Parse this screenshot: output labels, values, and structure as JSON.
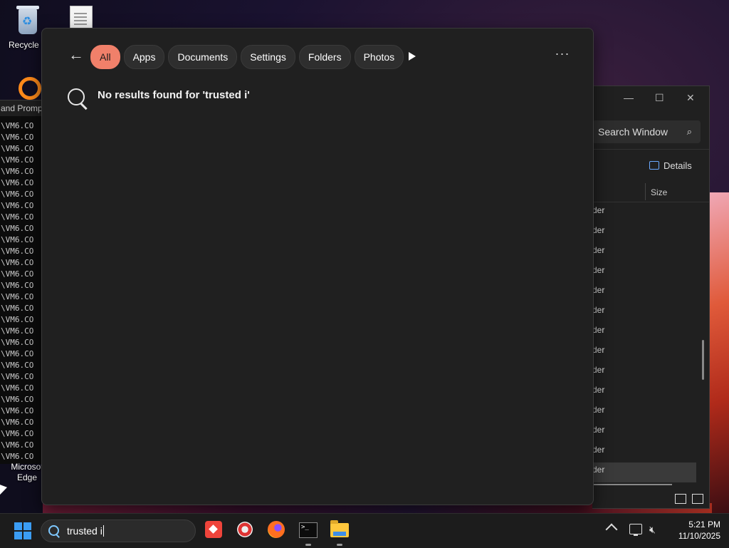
{
  "desktop": {
    "recycle_bin_label": "Recycle B",
    "edge_label_line1": "Microsof",
    "edge_label_line2": "Edge"
  },
  "cmd": {
    "title": "and Prompt",
    "line_text": "\\VM6.CO",
    "line_count": 30
  },
  "explorer": {
    "search_placeholder": "Search Window",
    "details_label": "Details",
    "size_header": "Size",
    "row_text": "der",
    "row_count": 14
  },
  "search": {
    "filters": [
      "All",
      "Apps",
      "Documents",
      "Settings",
      "Folders",
      "Photos"
    ],
    "active_filter": "All",
    "more_label": "···",
    "no_results_message": "No results found for 'trusted i'"
  },
  "taskbar": {
    "search_text": "trusted i",
    "time": "5:21 PM",
    "date": "11/10/2025"
  },
  "colors": {
    "accent_pill": "#f0806a",
    "start_blue": "#3b9df5"
  }
}
